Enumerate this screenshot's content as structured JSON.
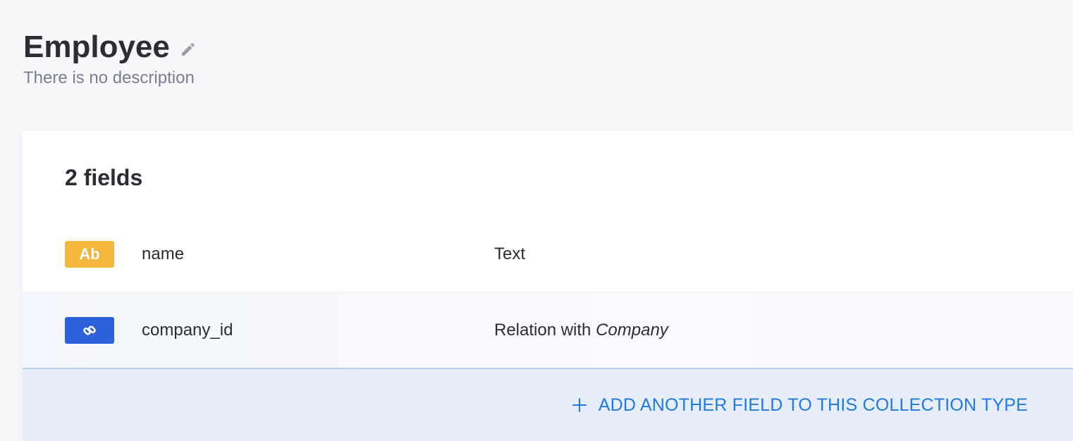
{
  "header": {
    "title": "Employee",
    "description": "There is no description",
    "edit_icon": "pencil-icon"
  },
  "fields_card": {
    "count_label": "2 fields",
    "rows": [
      {
        "badge_label": "Ab",
        "badge_icon": "text-type-icon",
        "badge_color": "#f4b73e",
        "name": "name",
        "type": "Text",
        "relation_target": ""
      },
      {
        "badge_label": "",
        "badge_icon": "link-icon",
        "badge_color": "#2d60db",
        "name": "company_id",
        "type": "Relation with",
        "relation_target": "Company"
      }
    ],
    "add_button": {
      "icon": "plus-icon",
      "label": "ADD ANOTHER FIELD TO THIS COLLECTION TYPE"
    }
  },
  "colors": {
    "accent": "#1e7ae5",
    "background": "#f7f7f9",
    "footer_bg": "#e7eef9"
  }
}
